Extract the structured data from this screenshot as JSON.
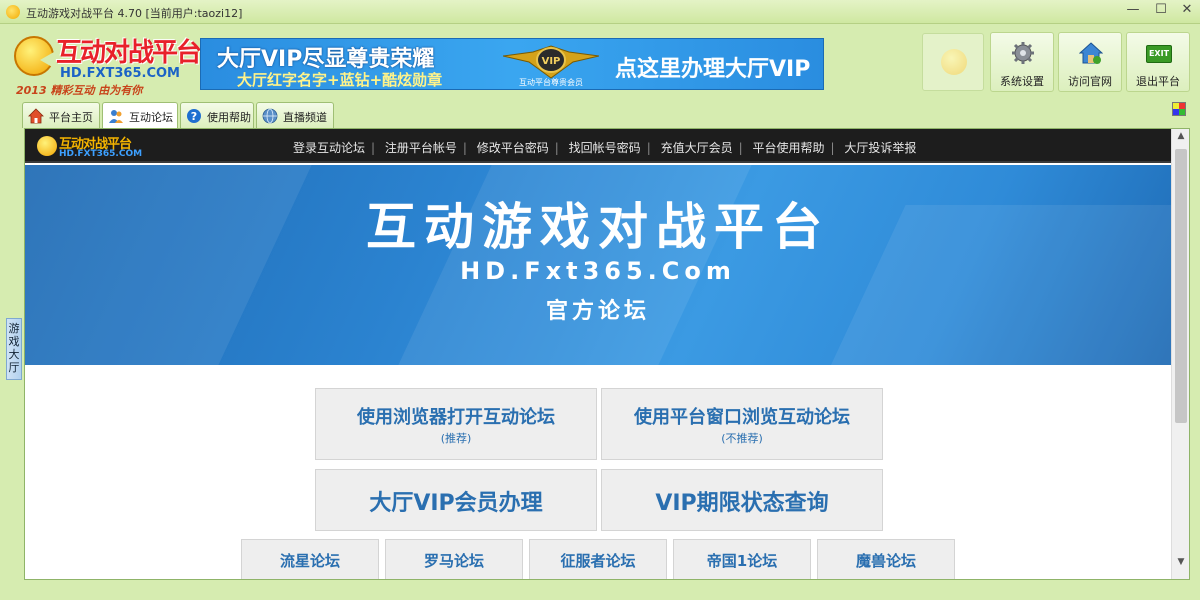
{
  "window": {
    "title": "互动游戏对战平台 4.70 [当前用户:taozi12]",
    "minimize": "—",
    "maximize": "☐",
    "close": "✕"
  },
  "logo": {
    "title": "互动对战平台",
    "url": "HD.FXT365.COM",
    "slogan": "2013 精彩互动 由为有你"
  },
  "banner": {
    "line1": "大厅VIP尽显尊贵荣耀",
    "line2": "大厅红字名字+蓝钻+酷炫勋章",
    "badge_text": "互动平台尊贵会员",
    "cta": "点这里办理大厅VIP"
  },
  "toolbar": {
    "settings_label": "系统设置",
    "site_label": "访问官网",
    "exit_label": "退出平台",
    "exit_icon_text": "EXIT"
  },
  "tabs": [
    {
      "label": "平台主页"
    },
    {
      "label": "互动论坛"
    },
    {
      "label": "使用帮助"
    },
    {
      "label": "直播频道"
    }
  ],
  "side_tab": {
    "label": "游戏大厅"
  },
  "nav": {
    "logo_title": "互动对战平台",
    "logo_url": "HD.FXT365.COM",
    "links": [
      "登录互动论坛",
      "注册平台帐号",
      "修改平台密码",
      "找回帐号密码",
      "充值大厅会员",
      "平台使用帮助",
      "大厅投诉举报"
    ],
    "separator": "|"
  },
  "hero": {
    "title": "互动游戏对战平台",
    "url": "HD.Fxt365.Com",
    "subtitle": "官方论坛"
  },
  "actions": {
    "browser_open": {
      "label": "使用浏览器打开互动论坛",
      "note": "(推荐)"
    },
    "window_browse": {
      "label": "使用平台窗口浏览互动论坛",
      "note": "(不推荐)"
    },
    "vip_signup": {
      "label": "大厅VIP会员办理"
    },
    "vip_query": {
      "label": "VIP期限状态查询"
    }
  },
  "forums": [
    {
      "label": "流星论坛"
    },
    {
      "label": "罗马论坛"
    },
    {
      "label": "征服者论坛"
    },
    {
      "label": "帝国1论坛"
    },
    {
      "label": "魔兽论坛"
    }
  ],
  "scroll": {
    "up": "▲",
    "down": "▼"
  }
}
